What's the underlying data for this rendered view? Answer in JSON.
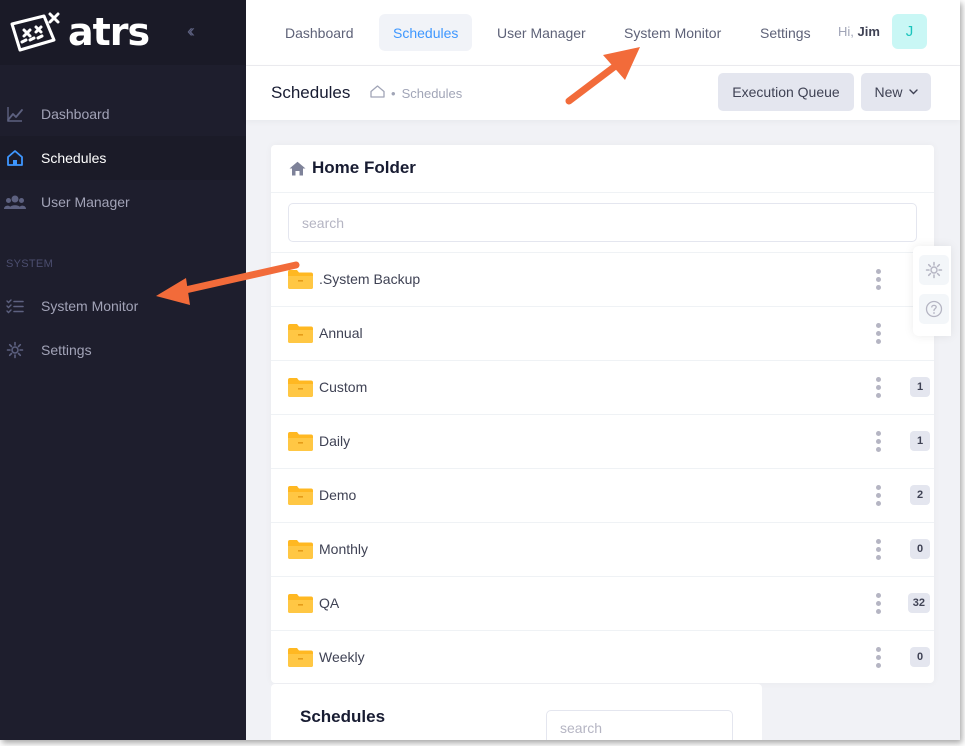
{
  "app": {
    "logo_text": "atrs"
  },
  "sidebar": {
    "items": [
      {
        "label": "Dashboard",
        "icon": "chart-line-icon"
      },
      {
        "label": "Schedules",
        "icon": "home-icon",
        "active": true
      },
      {
        "label": "User Manager",
        "icon": "users-icon"
      }
    ],
    "section_label": "SYSTEM",
    "system_items": [
      {
        "label": "System Monitor",
        "icon": "list-check-icon"
      },
      {
        "label": "Settings",
        "icon": "gear-icon"
      }
    ]
  },
  "topbar": {
    "tabs": [
      {
        "label": "Dashboard"
      },
      {
        "label": "Schedules",
        "active": true
      },
      {
        "label": "User Manager"
      },
      {
        "label": "System Monitor"
      },
      {
        "label": "Settings"
      }
    ],
    "greeting": "Hi,",
    "user_name": "Jim",
    "avatar_initial": "J"
  },
  "subheader": {
    "title": "Schedules",
    "breadcrumb_sep": "•",
    "breadcrumb": "Schedules",
    "execution_queue_label": "Execution Queue",
    "new_label": "New"
  },
  "folder_panel": {
    "title": "Home Folder",
    "search_placeholder": "search",
    "folders": [
      {
        "name": ".System Backup",
        "count": ""
      },
      {
        "name": "Annual",
        "count": ""
      },
      {
        "name": "Custom",
        "count": "1"
      },
      {
        "name": "Daily",
        "count": "1"
      },
      {
        "name": "Demo",
        "count": "2"
      },
      {
        "name": "Monthly",
        "count": "0"
      },
      {
        "name": "QA",
        "count": "32"
      },
      {
        "name": "Weekly",
        "count": "0"
      }
    ]
  },
  "schedules_panel": {
    "title": "Schedules",
    "search_placeholder": "search"
  },
  "colors": {
    "sidebar_bg": "#1e1e2d",
    "accent": "#3e97ff",
    "folder": "#ffb822",
    "annotation_arrow": "#f26b3a",
    "avatar_bg": "#c9f7f5",
    "avatar_fg": "#1bc5bd"
  }
}
